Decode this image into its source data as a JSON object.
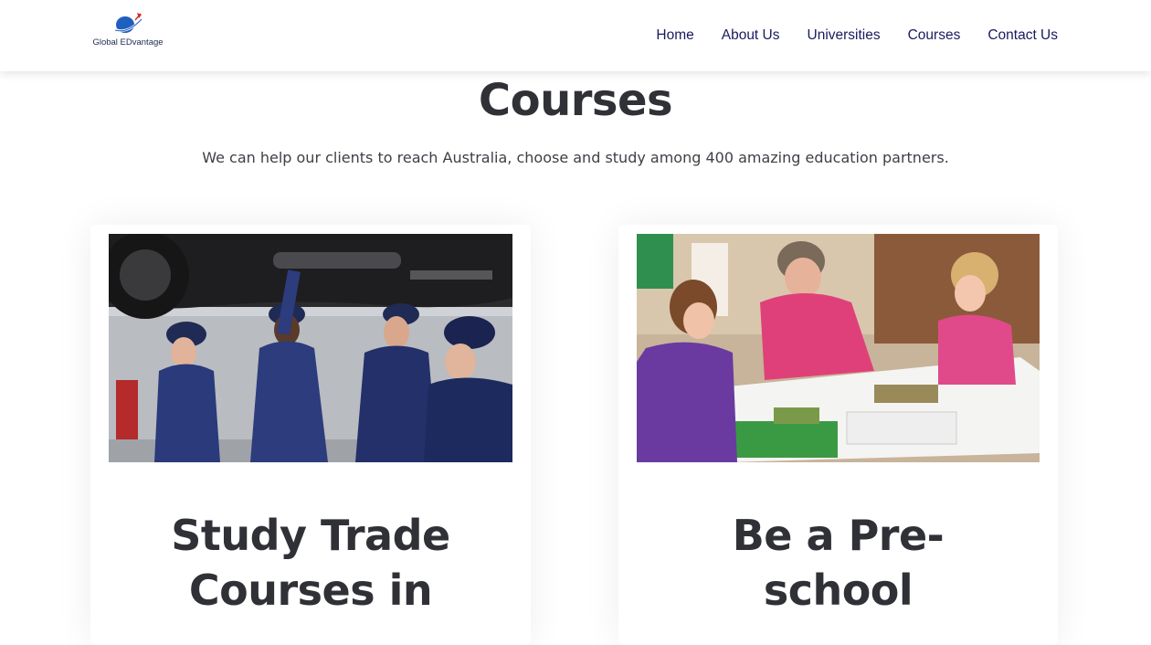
{
  "header": {
    "logo_text": "Global EDvantage",
    "nav": [
      "Home",
      "About Us",
      "Universities",
      "Courses",
      "Contact Us"
    ]
  },
  "hero": {
    "title": "Courses",
    "subtitle": "We can help our clients to reach Australia, choose and study among 400 amazing education partners."
  },
  "cards": [
    {
      "title_line1": "Study Trade",
      "title_line2": "Courses in",
      "image": "mechanics-under-car-photo"
    },
    {
      "title_line1": "Be a Pre-",
      "title_line2": "school",
      "image": "preschool-teacher-children-puzzle-photo"
    }
  ],
  "colors": {
    "nav_text": "#1a1a5e",
    "heading": "#2f3136",
    "logo_blue": "#1f5fbf",
    "logo_red": "#d62b2b"
  }
}
